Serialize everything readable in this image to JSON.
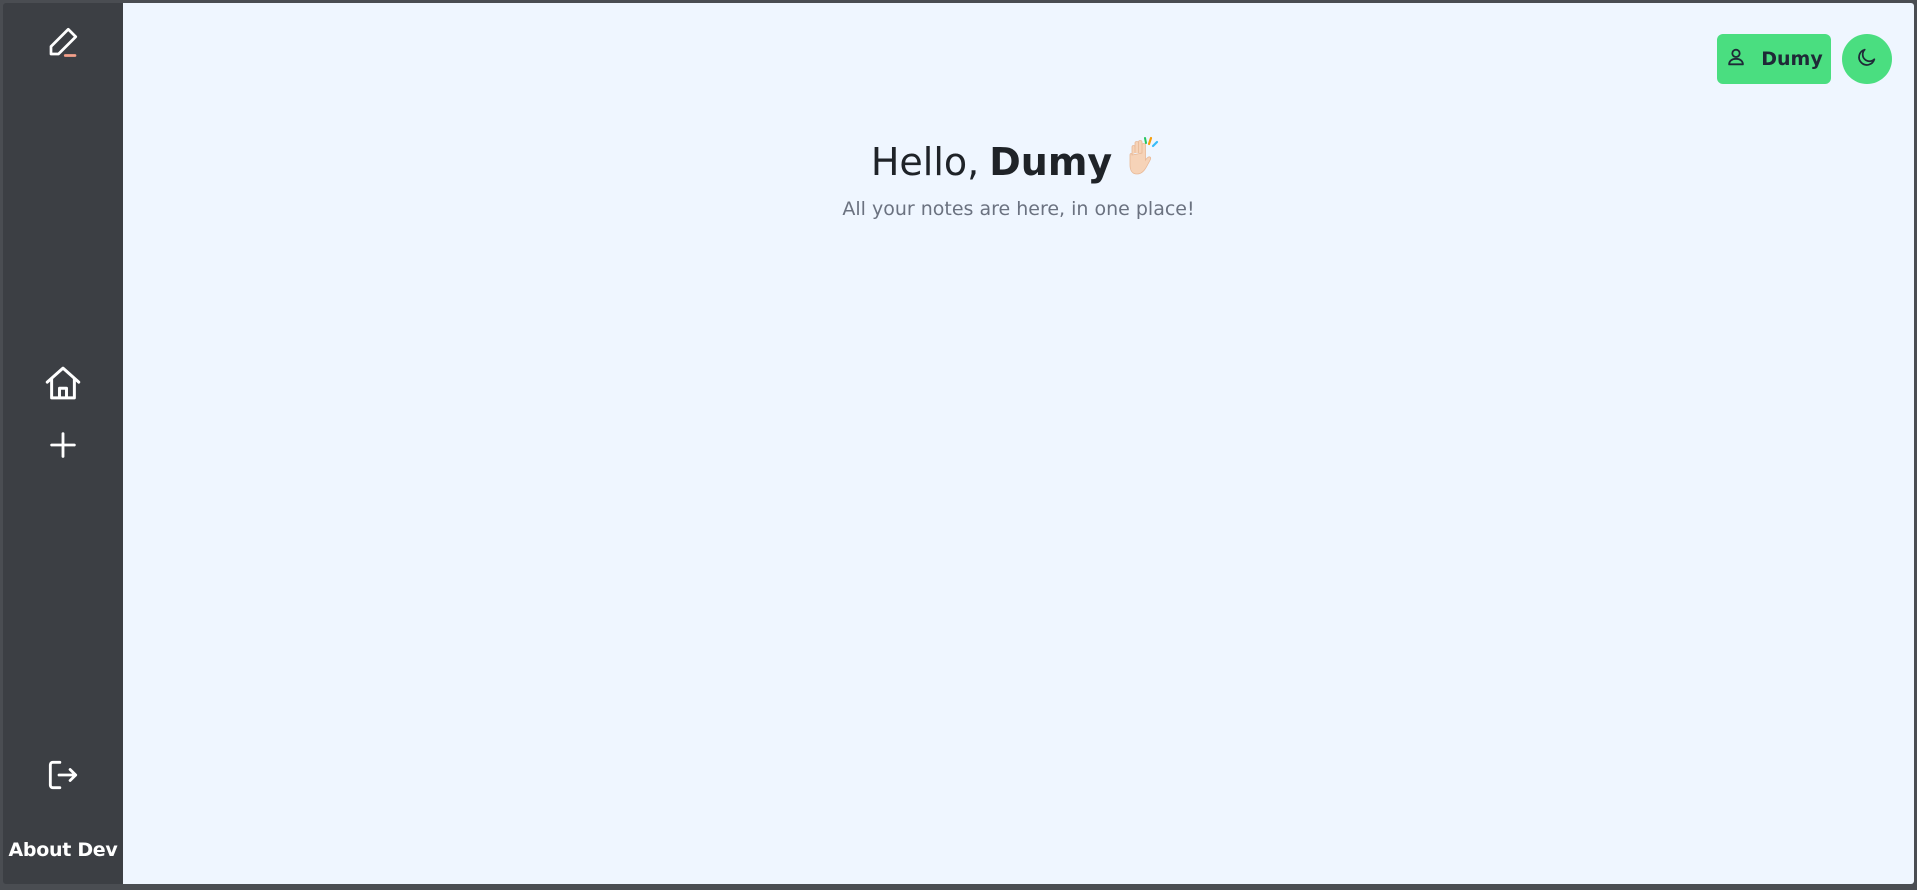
{
  "sidebar": {
    "logo_icon": "pencil-icon",
    "home_icon": "home-icon",
    "add_icon": "plus-icon",
    "logout_icon": "logout-icon",
    "about_label": "About Dev"
  },
  "header": {
    "user_name": "Dumy",
    "user_icon": "user-icon",
    "theme_icon": "moon-icon"
  },
  "greeting": {
    "hello": "Hello,",
    "name": "Dumy",
    "wave_icon": "waving-hand-icon",
    "subtitle": "All your notes are here, in one place!"
  },
  "colors": {
    "sidebar_bg": "#3c3f44",
    "main_bg": "#eff6ff",
    "accent": "#4ade80",
    "logo_underline": "#f4a08a"
  }
}
